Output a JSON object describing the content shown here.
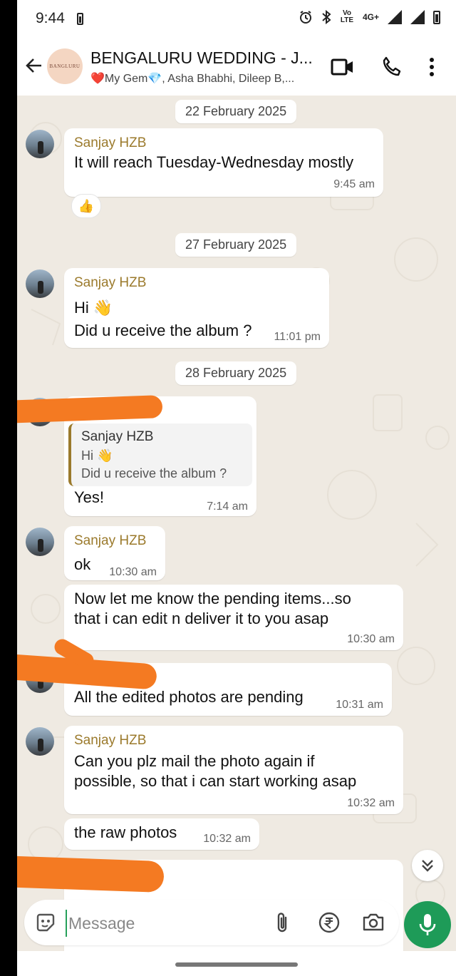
{
  "status_bar": {
    "time": "9:44",
    "network_label": "Vo LTE",
    "network_type": "4G+"
  },
  "header": {
    "avatar_text": "BANGLURU",
    "title": "BENGALURU WEDDING - J...",
    "subtitle": "❤️My Gem💎, Asha Bhabhi, Dileep B,..."
  },
  "chat": {
    "dates": [
      "22 February 2025",
      "27 February 2025",
      "28 February 2025"
    ],
    "messages": [
      {
        "sender": "Sanjay HZB",
        "text": "It will reach Tuesday-Wednesday mostly",
        "time": "9:45 am",
        "reaction": "👍"
      },
      {
        "sender": "Sanjay HZB",
        "text": "Hi 👋\nDid u receive the album ?",
        "time": "11:01 pm"
      },
      {
        "quote_sender": "Sanjay HZB",
        "quote_line1": "Hi 👋",
        "quote_line2": "Did u receive the album ?",
        "text": "Yes!",
        "time": "7:14 am"
      },
      {
        "sender": "Sanjay HZB",
        "text": "ok",
        "time": "10:30 am"
      },
      {
        "text": "Now let me know the pending items...so\nthat i can edit n deliver it to you asap",
        "time": "10:30 am"
      },
      {
        "text": "All the edited photos are pending",
        "time": "10:31 am"
      },
      {
        "sender": "Sanjay HZB",
        "text": "Can you plz mail the photo again if\npossible, so that i can start working asap",
        "time": "10:32 am"
      },
      {
        "text": "the raw photos",
        "time": "10:32 am"
      }
    ]
  },
  "composer": {
    "placeholder": "Message"
  },
  "colors": {
    "accent_green": "#1e9b58",
    "sender_name": "#9b7a2c",
    "chat_bg": "#efeae2",
    "redaction": "#f47a22"
  }
}
